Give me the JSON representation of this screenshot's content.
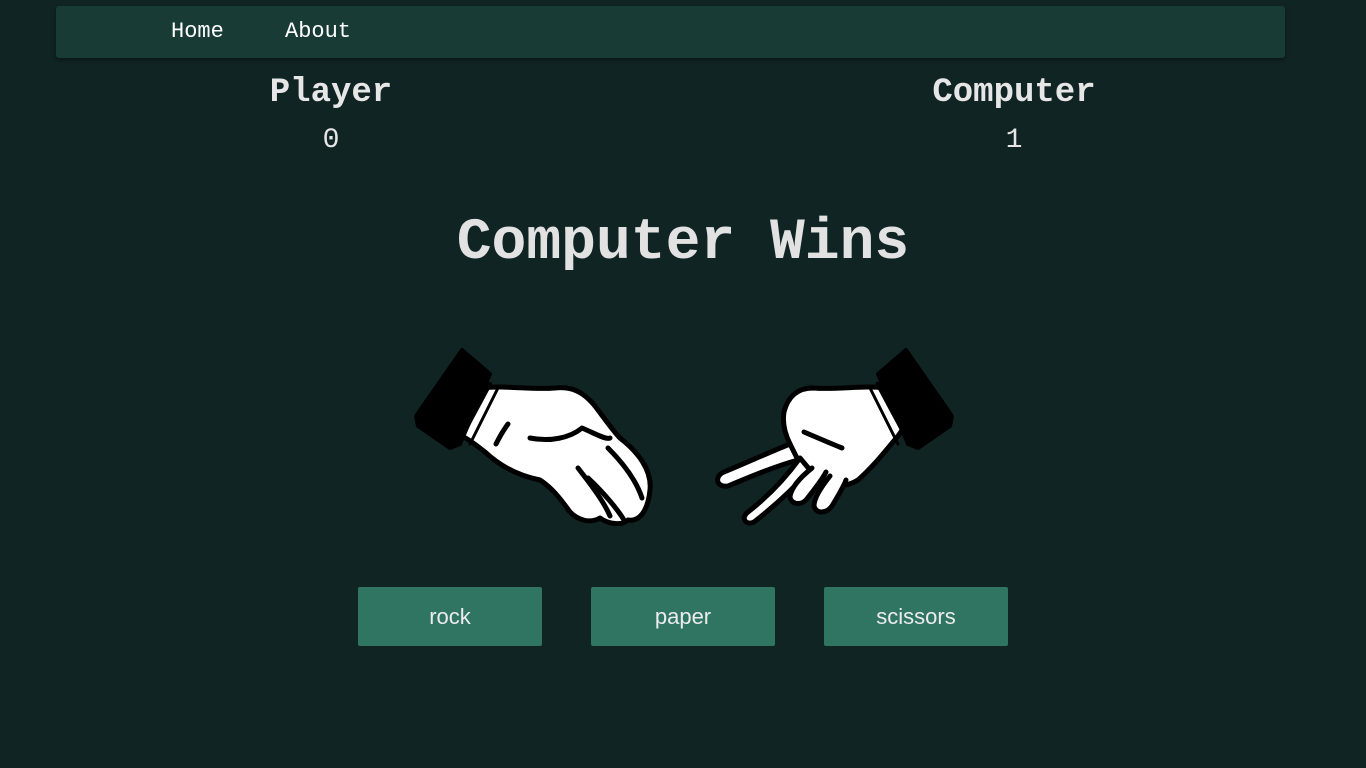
{
  "nav": {
    "home": "Home",
    "about": "About"
  },
  "scoreboard": {
    "player": {
      "label": "Player",
      "score": "0"
    },
    "computer": {
      "label": "Computer",
      "score": "1"
    }
  },
  "result": "Computer Wins",
  "hands": {
    "player": "rock-hand-icon",
    "computer": "scissors-hand-icon"
  },
  "choices": {
    "rock": "rock",
    "paper": "paper",
    "scissors": "scissors"
  },
  "colors": {
    "background": "#112424",
    "navbar": "#183c35",
    "button": "#2f7562",
    "text": "#e6e6e6"
  }
}
